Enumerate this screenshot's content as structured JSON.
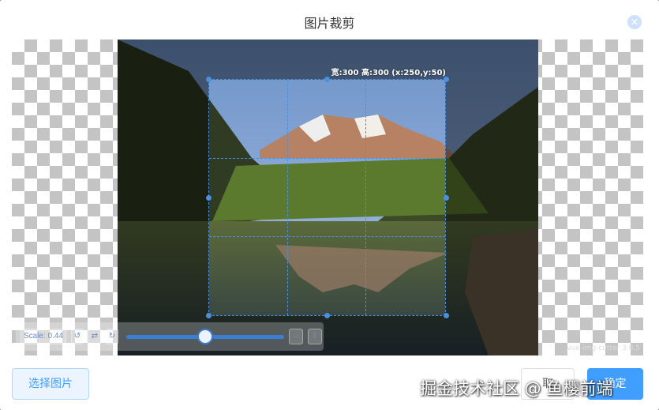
{
  "dialog": {
    "title": "图片裁剪",
    "close_icon": "close-icon"
  },
  "cropper": {
    "size_label": "宽:300 高:300 (x:250,y:50)",
    "watermark": "vue-img-cutter 3.0.5",
    "scale_label": "Scale: 0.44",
    "scale_value": 0.44,
    "icons": [
      "rotate-left-icon",
      "flip-icon",
      "rotate-right-icon",
      "fit-width-icon",
      "fit-height-icon"
    ]
  },
  "footer": {
    "select_label": "选择图片",
    "cancel_label": "取",
    "confirm_label": "确定"
  },
  "overlay": {
    "site_mark": "掘金技术社区 @ 鱼樱前端"
  },
  "colors": {
    "accent": "#409eff",
    "crop_border": "#4a90e2"
  }
}
